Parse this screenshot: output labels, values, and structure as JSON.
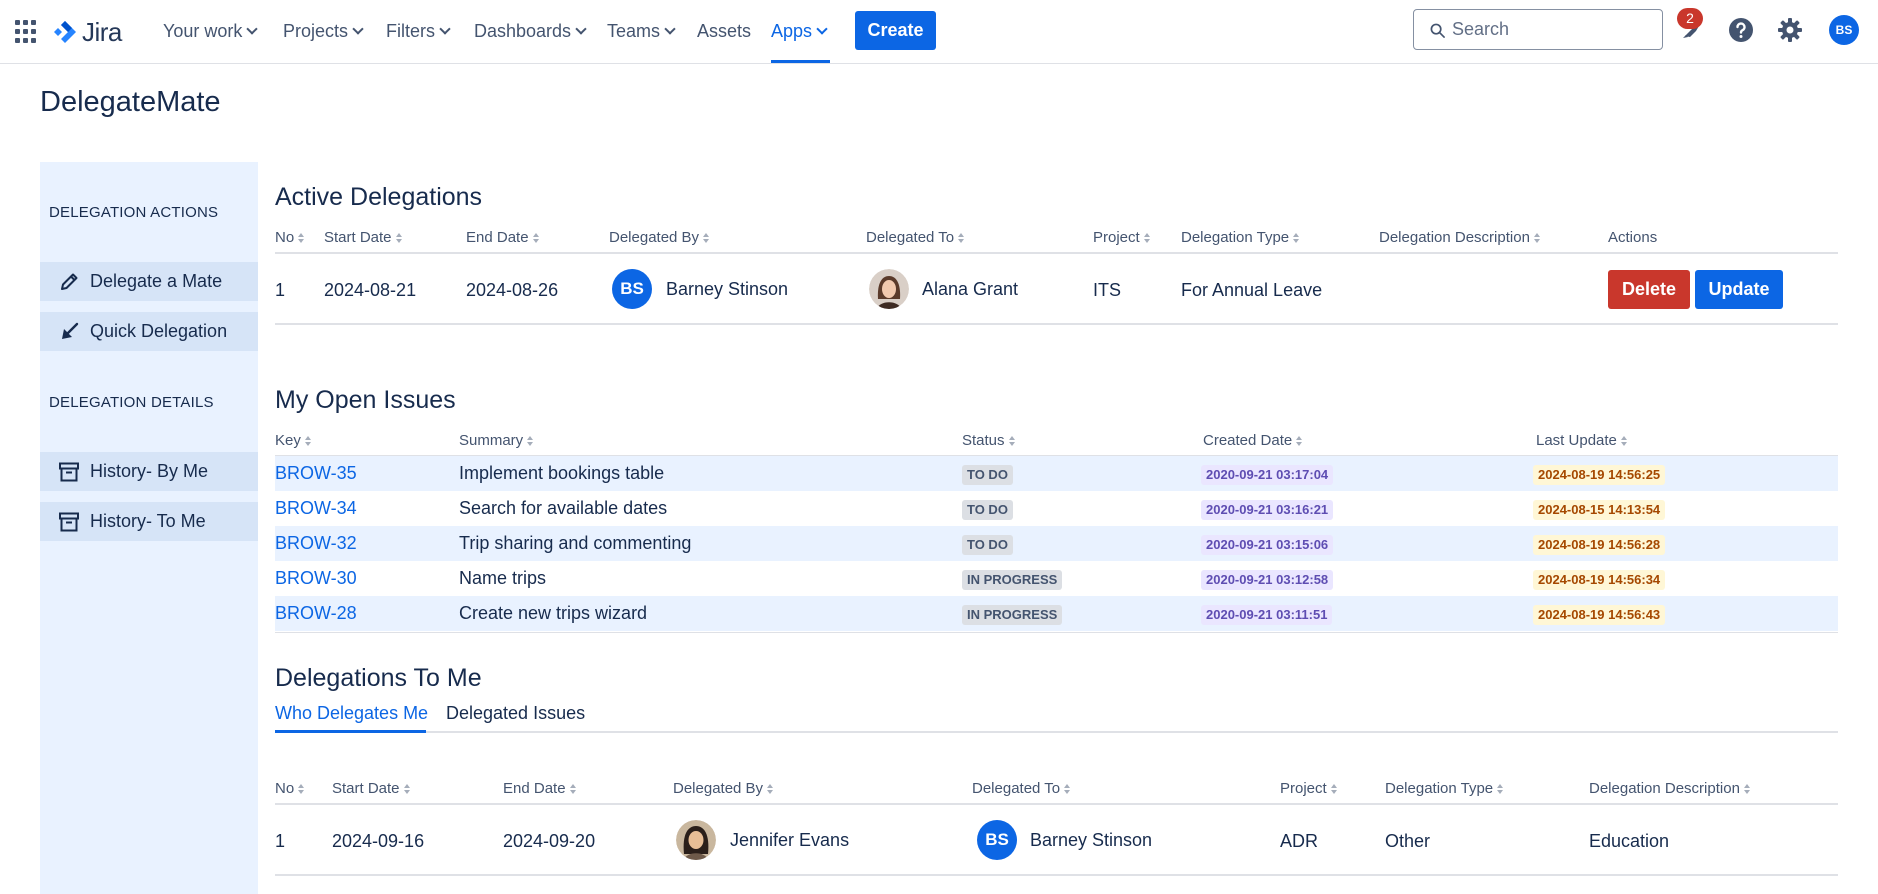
{
  "nav": {
    "app_name": "Jira",
    "items": [
      {
        "label": "Your work",
        "dropdown": true
      },
      {
        "label": "Projects",
        "dropdown": true
      },
      {
        "label": "Filters",
        "dropdown": true
      },
      {
        "label": "Dashboards",
        "dropdown": true
      },
      {
        "label": "Teams",
        "dropdown": true
      },
      {
        "label": "Assets",
        "dropdown": false
      },
      {
        "label": "Apps",
        "dropdown": true,
        "active": true
      }
    ],
    "create_label": "Create",
    "search_placeholder": "Search",
    "notification_count": "2",
    "user_initials": "BS"
  },
  "page_title": "DelegateMate",
  "sidebar": {
    "actions_heading": "DELEGATION ACTIONS",
    "actions": [
      {
        "label": "Delegate a Mate",
        "icon": "pencil-icon"
      },
      {
        "label": "Quick Delegation",
        "icon": "arrow-down-left-icon"
      }
    ],
    "details_heading": "DELEGATION DETAILS",
    "details": [
      {
        "label": "History- By Me",
        "icon": "archive-icon"
      },
      {
        "label": "History- To Me",
        "icon": "archive-icon"
      }
    ]
  },
  "active_delegations": {
    "title": "Active Delegations",
    "headers": [
      "No",
      "Start Date",
      "End Date",
      "Delegated By",
      "Delegated To",
      "Project",
      "Delegation Type",
      "Delegation Description",
      "Actions"
    ],
    "rows": [
      {
        "no": "1",
        "start": "2024-08-21",
        "end": "2024-08-26",
        "by": "Barney Stinson",
        "by_initials": "BS",
        "to": "Alana Grant",
        "project": "ITS",
        "type": "For Annual Leave",
        "description": "",
        "delete_label": "Delete",
        "update_label": "Update"
      }
    ]
  },
  "open_issues": {
    "title": "My Open Issues",
    "headers": [
      "Key",
      "Summary",
      "Status",
      "Created Date",
      "Last Update"
    ],
    "rows": [
      {
        "key": "BROW-35",
        "summary": "Implement bookings table",
        "status": "TO DO",
        "created": "2020-09-21 03:17:04",
        "updated": "2024-08-19 14:56:25"
      },
      {
        "key": "BROW-34",
        "summary": "Search for available dates",
        "status": "TO DO",
        "created": "2020-09-21 03:16:21",
        "updated": "2024-08-15 14:13:54"
      },
      {
        "key": "BROW-32",
        "summary": "Trip sharing and commenting",
        "status": "TO DO",
        "created": "2020-09-21 03:15:06",
        "updated": "2024-08-19 14:56:28"
      },
      {
        "key": "BROW-30",
        "summary": "Name trips",
        "status": "IN PROGRESS",
        "created": "2020-09-21 03:12:58",
        "updated": "2024-08-19 14:56:34"
      },
      {
        "key": "BROW-28",
        "summary": "Create new trips wizard",
        "status": "IN PROGRESS",
        "created": "2020-09-21 03:11:51",
        "updated": "2024-08-19 14:56:43"
      }
    ]
  },
  "delegations_to_me": {
    "title": "Delegations To Me",
    "tabs": [
      {
        "label": "Who Delegates Me",
        "active": true
      },
      {
        "label": "Delegated Issues",
        "active": false
      }
    ],
    "headers": [
      "No",
      "Start Date",
      "End Date",
      "Delegated By",
      "Delegated To",
      "Project",
      "Delegation Type",
      "Delegation Description"
    ],
    "rows": [
      {
        "no": "1",
        "start": "2024-09-16",
        "end": "2024-09-20",
        "by": "Jennifer Evans",
        "to": "Barney Stinson",
        "to_initials": "BS",
        "project": "ADR",
        "type": "Other",
        "description": "Education"
      }
    ]
  },
  "colors": {
    "brand": "#0C66E4",
    "danger": "#C9372C",
    "sidebar_bg": "#E9F2FF"
  }
}
